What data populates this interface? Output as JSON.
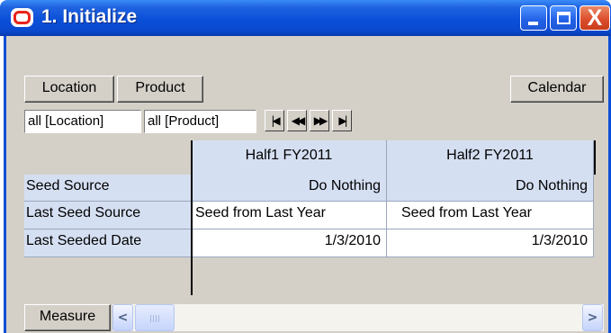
{
  "window": {
    "title": "1. Initialize",
    "app_icon": "oracle-logo-icon",
    "controls": {
      "minimize_icon": "minimize-icon",
      "maximize_icon": "maximize-icon",
      "close_icon": "close-icon",
      "close_glyph": "X"
    }
  },
  "toolbar": {
    "location_label": "Location",
    "product_label": "Product",
    "calendar_label": "Calendar"
  },
  "filters": {
    "location_value": "all [Location]",
    "product_value": "all [Product]"
  },
  "pager": {
    "first": "|◀",
    "prev": "◀◀",
    "next": "▶▶",
    "last": "▶|"
  },
  "grid": {
    "columns": [
      "Half1 FY2011",
      "Half2 FY2011"
    ],
    "rows": [
      {
        "label": "Seed Source",
        "cells": [
          "Do Nothing",
          "Do Nothing"
        ]
      },
      {
        "label": "Last Seed Source",
        "cells": [
          "Seed from Last Year",
          "Seed from Last Year"
        ]
      },
      {
        "label": "Last Seeded Date",
        "cells": [
          "1/3/2010",
          "1/3/2010"
        ]
      }
    ]
  },
  "footer": {
    "measure_label": "Measure",
    "scroll_left": "<",
    "scroll_right": ">"
  },
  "colors": {
    "titlebar_blue": "#0a4fd8",
    "header_blue": "#d5dff2",
    "face_gray": "#d4d0c8",
    "close_red": "#dc4e2c",
    "logo_red": "#e8231b"
  }
}
